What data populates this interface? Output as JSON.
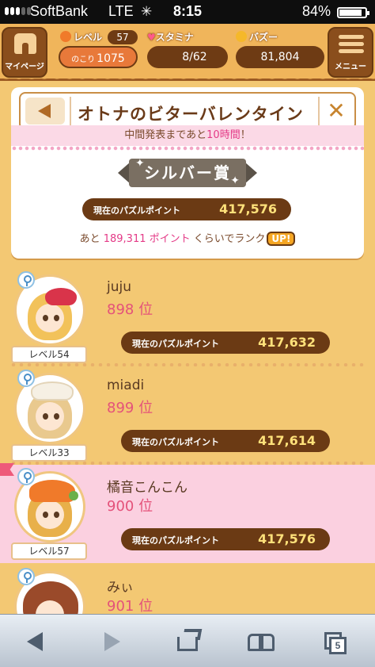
{
  "status_bar": {
    "carrier": "SoftBank",
    "network": "LTE",
    "time": "8:15",
    "battery": "84%",
    "battery_level": 0.84
  },
  "header": {
    "mypage_label": "マイページ",
    "level_label": "レベル",
    "level_value": "57",
    "remain_label": "のこり",
    "remain_value": "1075",
    "stamina_label": "スタミナ",
    "stamina_value": "8/62",
    "buzz_label": "バズー",
    "buzz_value": "81,804",
    "menu_label": "メニュー"
  },
  "event": {
    "title": "オトナのビターバレンタイン",
    "notice_prefix": "中間発表まであと",
    "notice_highlight": "10時間",
    "notice_suffix": "！",
    "rank_title": "シルバー賞",
    "points_label": "現在のパズルポイント",
    "points_value": "417,576",
    "rankup_prefix": "あと",
    "rankup_number": "189,311 ポイント",
    "rankup_suffix": "くらいでランク",
    "rankup_badge": "UP!"
  },
  "ranking": [
    {
      "name": "juju",
      "rank": "898 位",
      "level": "レベル54",
      "points_label": "現在のパズルポイント",
      "points": "417,632",
      "me": false
    },
    {
      "name": "miadi",
      "rank": "899 位",
      "level": "レベル33",
      "points_label": "現在のパズルポイント",
      "points": "417,614",
      "me": false
    },
    {
      "name": "橘音こんこん",
      "rank": "900 位",
      "level": "レベル57",
      "points_label": "現在のパズルポイント",
      "points": "417,576",
      "me": true
    },
    {
      "name": "みぃ",
      "rank": "901 位",
      "level": "",
      "points_label": "",
      "points": "",
      "me": false
    }
  ],
  "toolbar": {
    "tab_count": "5"
  },
  "colors": {
    "background": "#f3c873",
    "header_brown": "#6e3b14",
    "pink_highlight": "#e43a87",
    "rank_pink": "#e4527a",
    "my_row": "#fbd0e0"
  }
}
